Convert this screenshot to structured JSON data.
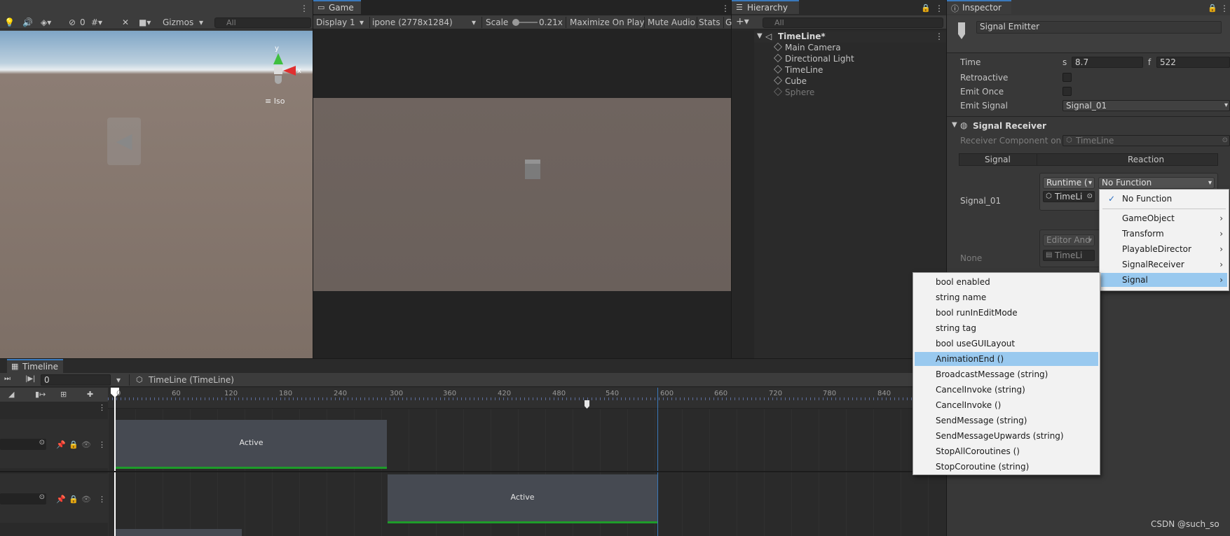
{
  "scene": {
    "toolbar_count": "0",
    "gizmos_label": "Gizmos",
    "search_placeholder": "All",
    "axis_y": "y",
    "axis_x": "x",
    "iso_label": "Iso"
  },
  "game": {
    "tab_label": "Game",
    "display_label": "Display 1",
    "resolution_label": "ipone (2778x1284)",
    "scale_label": "Scale",
    "scale_value": "0.21x",
    "maximize_label": "Maximize On Play",
    "mute_label": "Mute Audio",
    "stats_label": "Stats",
    "gizmos_label": "G"
  },
  "hierarchy": {
    "tab_label": "Hierarchy",
    "search_placeholder": "All",
    "root": "TimeLine*",
    "items": [
      "Main Camera",
      "Directional Light",
      "TimeLine",
      "Cube",
      "Sphere"
    ]
  },
  "inspector": {
    "tab_label": "Inspector",
    "object_name": "Signal Emitter",
    "time_label": "Time",
    "time_s_label": "s",
    "time_s_value": "8.7",
    "time_f_label": "f",
    "time_f_value": "522",
    "retroactive_label": "Retroactive",
    "emit_once_label": "Emit Once",
    "emit_signal_label": "Emit Signal",
    "emit_signal_value": "Signal_01",
    "receiver_title": "Signal Receiver",
    "receiver_component_label": "Receiver Component on",
    "receiver_component_value": "TimeLine",
    "col_signal": "Signal",
    "col_reaction": "Reaction",
    "row1_signal": "Signal_01",
    "row1_runtime": "Runtime (",
    "row1_function": "No Function",
    "row1_object": "TimeLi",
    "row2_signal": "None",
    "row2_runtime": "Editor And",
    "row2_object": "TimeLi"
  },
  "function_menu": {
    "items": [
      "No Function",
      "GameObject",
      "Transform",
      "PlayableDirector",
      "SignalReceiver",
      "Signal"
    ],
    "checked": "No Function",
    "highlighted": "Signal"
  },
  "signal_submenu": {
    "items": [
      "bool enabled",
      "string name",
      "bool runInEditMode",
      "string tag",
      "bool useGUILayout",
      "AnimationEnd ()",
      "BroadcastMessage (string)",
      "CancelInvoke (string)",
      "CancelInvoke ()",
      "SendMessage (string)",
      "SendMessageUpwards (string)",
      "StopAllCoroutines ()",
      "StopCoroutine (string)"
    ],
    "highlighted": "AnimationEnd ()"
  },
  "timeline": {
    "tab_label": "Timeline",
    "frame_value": "0",
    "asset_label": "TimeLine (TimeLine)",
    "ruler": [
      "0",
      "60",
      "120",
      "180",
      "240",
      "300",
      "360",
      "420",
      "480",
      "540",
      "600",
      "660",
      "720",
      "780",
      "840"
    ],
    "clip1_label": "Active",
    "clip2_label": "Active"
  },
  "watermark": "CSDN @such_so",
  "colors": {
    "accent_blue": "#3a79bb",
    "menu_highlight": "#99c9ef",
    "clip_green": "#1e9c2a"
  }
}
